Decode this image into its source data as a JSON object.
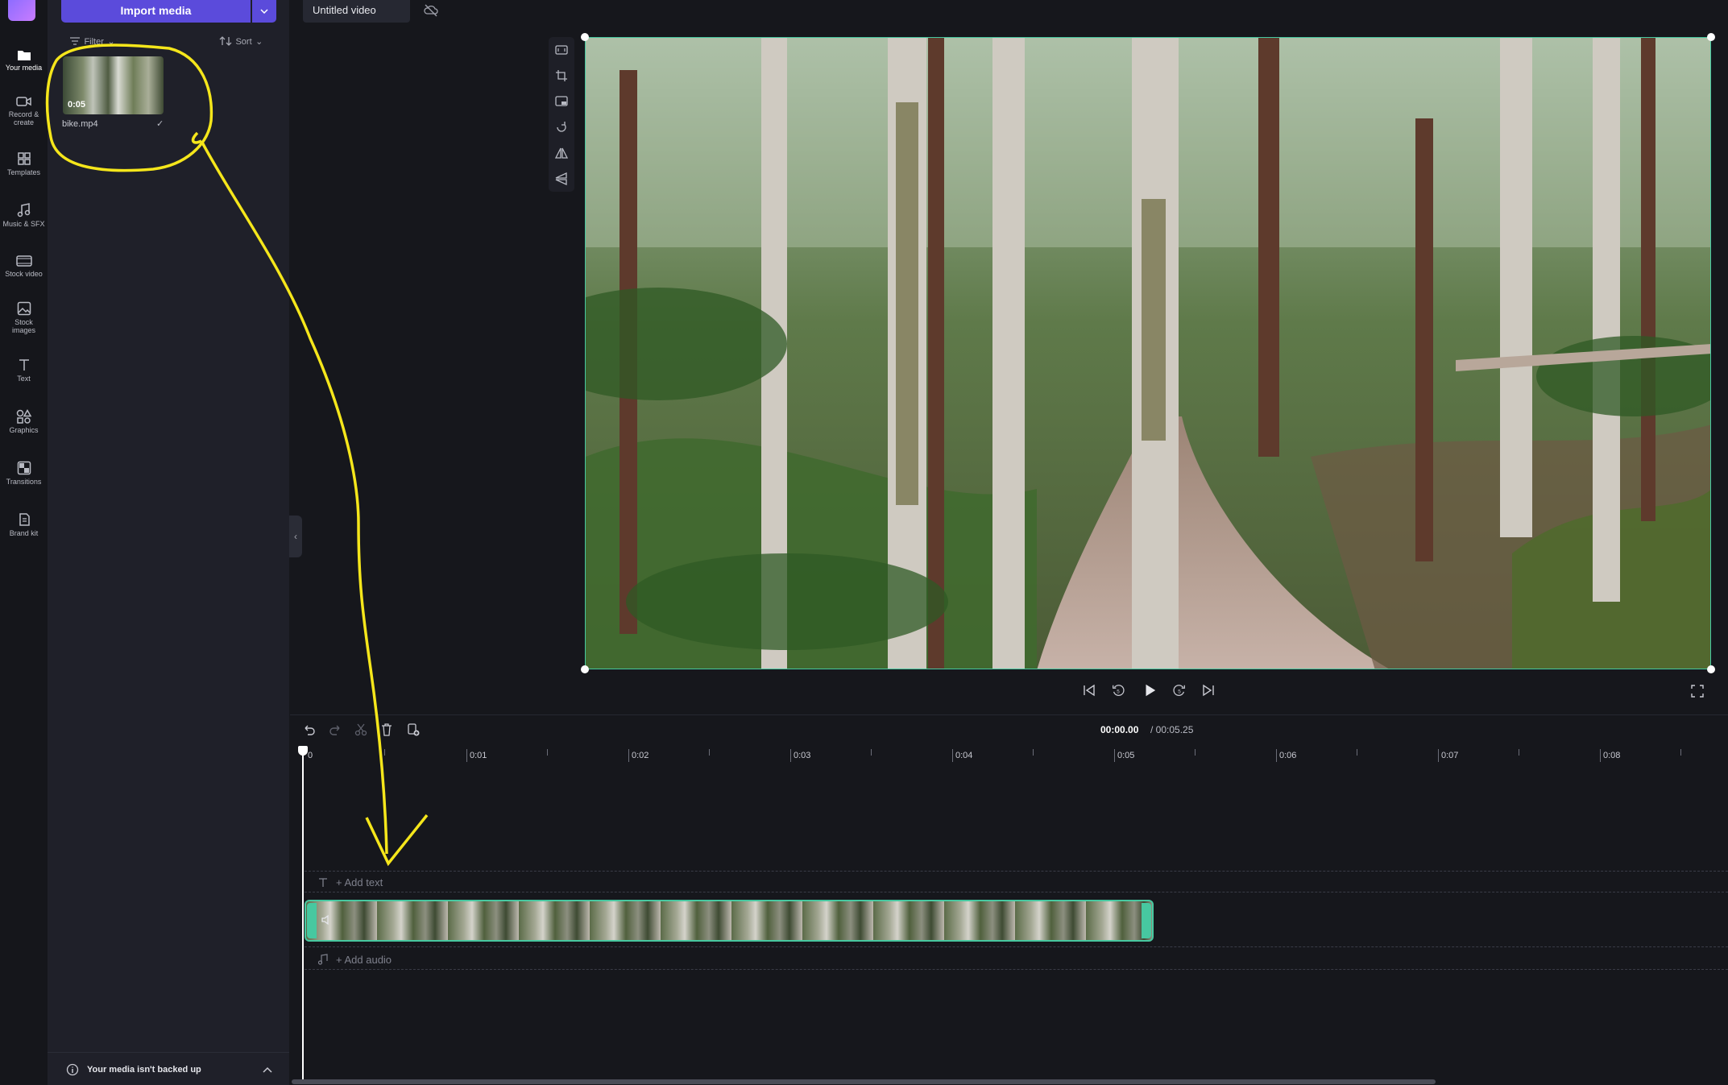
{
  "rail": {
    "items": [
      {
        "label": "Your media"
      },
      {
        "label": "Record & create"
      },
      {
        "label": "Templates"
      },
      {
        "label": "Music & SFX"
      },
      {
        "label": "Stock video"
      },
      {
        "label": "Stock images"
      },
      {
        "label": "Text"
      },
      {
        "label": "Graphics"
      },
      {
        "label": "Transitions"
      },
      {
        "label": "Brand kit"
      }
    ]
  },
  "panel": {
    "import_label": "Import media",
    "filter_label": "Filter",
    "sort_label": "Sort",
    "media": [
      {
        "name": "bike.mp4",
        "duration": "0:05"
      }
    ],
    "backup_text": "Your media isn't backed up"
  },
  "project": {
    "title": "Untitled video"
  },
  "timeline": {
    "current_time": "00:00.00",
    "total_time": "/ 00:05.25",
    "ruler": [
      "0",
      "0:01",
      "0:02",
      "0:03",
      "0:04",
      "0:05",
      "0:06",
      "0:07",
      "0:08"
    ],
    "add_text": "+ Add text",
    "add_audio": "+ Add audio"
  },
  "colors": {
    "accent": "#5b4bdb",
    "clip_border": "#47c8a0",
    "annotation": "#f5e61b"
  }
}
